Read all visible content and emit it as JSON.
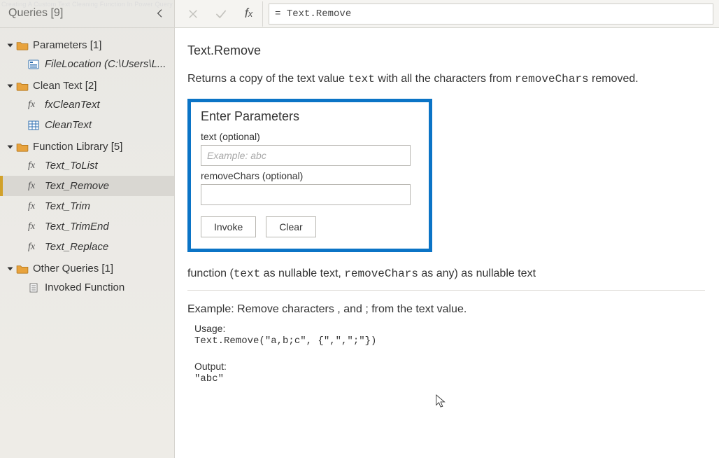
{
  "watermark": "Creating A Custom Text Cleaning Function In Power Query",
  "sidebar": {
    "title": "Queries [9]",
    "groups": [
      {
        "label": "Parameters [1]",
        "items": [
          {
            "icon": "param",
            "label": "FileLocation (C:\\Users\\L...",
            "italic": true
          }
        ]
      },
      {
        "label": "Clean Text [2]",
        "items": [
          {
            "icon": "fx",
            "label": "fxCleanText",
            "italic": true
          },
          {
            "icon": "table",
            "label": "CleanText",
            "italic": true
          }
        ]
      },
      {
        "label": "Function Library [5]",
        "items": [
          {
            "icon": "fx",
            "label": "Text_ToList",
            "italic": true
          },
          {
            "icon": "fx",
            "label": "Text_Remove",
            "italic": true,
            "selected": true
          },
          {
            "icon": "fx",
            "label": "Text_Trim",
            "italic": true
          },
          {
            "icon": "fx",
            "label": "Text_TrimEnd",
            "italic": true
          },
          {
            "icon": "fx",
            "label": "Text_Replace",
            "italic": true
          }
        ]
      },
      {
        "label": "Other Queries [1]",
        "items": [
          {
            "icon": "script",
            "label": "Invoked Function",
            "italic": false
          }
        ]
      }
    ]
  },
  "formula_bar": {
    "formula": "= Text.Remove"
  },
  "function": {
    "name": "Text.Remove",
    "description_pre": "Returns a copy of the text value ",
    "description_arg1": "text",
    "description_mid": " with all the characters from ",
    "description_arg2": "removeChars",
    "description_post": " removed.",
    "enter_params_title": "Enter Parameters",
    "params": [
      {
        "label": "text (optional)",
        "placeholder": "Example: abc"
      },
      {
        "label": "removeChars (optional)",
        "placeholder": ""
      }
    ],
    "invoke_label": "Invoke",
    "clear_label": "Clear",
    "signature_pre": "function (",
    "signature_a1": "text",
    "signature_mid1": " as nullable text, ",
    "signature_a2": "removeChars",
    "signature_mid2": " as any) as nullable text",
    "example_title": "Example: Remove characters , and ; from the text value.",
    "usage_label": "Usage:",
    "usage_code": "Text.Remove(\"a,b;c\", {\",\",\";\"})",
    "output_label": "Output:",
    "output_code": "\"abc\""
  }
}
